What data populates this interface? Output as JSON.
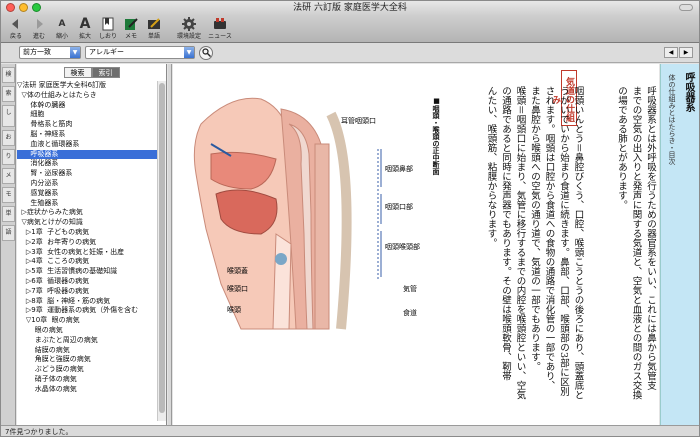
{
  "window": {
    "title": "法研 六訂版 家庭医学大全科",
    "colors": {
      "close": "#ff5f57",
      "minimize": "#ffbd2e",
      "zoom": "#28c940",
      "selection": "#3a6fd8",
      "accent_red": "#c0392b",
      "section_blue": "#c4e6f5"
    }
  },
  "toolbar": [
    {
      "icon": "back-arrow-icon",
      "label": "戻る"
    },
    {
      "icon": "forward-arrow-icon",
      "label": "進む"
    },
    {
      "icon": "text-smaller-icon",
      "label": "縮小"
    },
    {
      "icon": "text-larger-icon",
      "label": "拡大"
    },
    {
      "icon": "bookmark-icon",
      "label": "しおり"
    },
    {
      "icon": "memo-icon",
      "label": "メモ"
    },
    {
      "icon": "vocabulary-icon",
      "label": "単語"
    },
    {
      "icon": "gear-icon",
      "label": "環境設定"
    },
    {
      "icon": "news-icon",
      "label": "ニュース"
    }
  ],
  "search": {
    "mode_value": "前方一致",
    "query_value": "アレルギー"
  },
  "left_tabs": [
    "検",
    "索",
    "し",
    "お",
    "り",
    "メ",
    "モ",
    "単",
    "語"
  ],
  "tree": {
    "tabs": [
      "検索",
      "索引"
    ],
    "items": [
      "▽法研 家庭医学大全科6訂版",
      "  ▽体の仕組みとはたらき",
      "      体幹の臓器",
      "      細胞",
      "      骨格系と筋肉",
      "      脳・神経系",
      "      血液と循環器系",
      "      呼吸器系",
      "      消化器系",
      "      腎・泌尿器系",
      "      内分泌系",
      "      感覚器系",
      "      生殖器系",
      "  ▷症状からみた病気",
      "  ▽病気とけがの知識",
      "    ▷1章  子どもの病気",
      "    ▷2章  お年寄りの病気",
      "    ▷3章  女性の病気と妊娠・出産",
      "    ▷4章  こころの病気",
      "    ▷5章  生活習慣病の基礎知識",
      "    ▷6章  循環器の病気",
      "    ▷7章  呼吸器の病気",
      "    ▷8章  脳・神経・筋の病気",
      "    ▷9章  運動器系の病気（外傷を含む",
      "    ▽10章  眼の病気",
      "        眼の病気",
      "        まぶたと周辺の病気",
      "        結膜の病気",
      "        角膜と強膜の病気",
      "        ぶどう膜の病気",
      "        硝子体の病気",
      "        水晶体の病気"
    ],
    "selected_index": 7
  },
  "figure": {
    "caption": "■咽頭・喉頭の正中断面",
    "labels": {
      "nasopharynx_orifice": "耳管咽頭口",
      "nasopharynx": "咽頭鼻部",
      "oropharynx": "咽頭口部",
      "laryngopharynx": "咽頭喉頭部",
      "vestibule": "喉頭蓋",
      "larynx_orifice": "喉頭口",
      "larynx": "喉頭",
      "trachea": "気管",
      "esophagus": "食道"
    }
  },
  "section": {
    "title": "呼吸器系",
    "subtitle": "体の仕組みとはたらき・目次",
    "box_heading": "気道の仕組み"
  },
  "body_columns": [
    "呼吸器系とは外呼吸を行うための器官系をいい、これには鼻から気管支",
    "までの空気の出入りと発声に関する気道と、空気と血液との間のガス交換",
    "の場である肺とがあります。",
    "",
    "",
    "咽頭いんとう＝鼻腔びくう、口腔、喉頭こうとうの後ろにあり、頭蓋底と",
    "うがいでいから始まり食道に続きます。鼻部、口部、喉頭部の3部に区別",
    "されます。咽頭は口腔から食道への食物の通路で消化管の一部であり、",
    "また鼻腔から喉頭への空気の通り道で、気道の一部でもあります。",
    "喉頭＝咽頭口に始まり、気管に移行するまでの内腔を喉頭腔といい、空気",
    "の通路であると同時に発声器でもあります。その壁は喉頭軟骨、靭帯",
    "んたい、喉頭筋、粘膜からなります。"
  ],
  "status": "7件見つかりました。"
}
